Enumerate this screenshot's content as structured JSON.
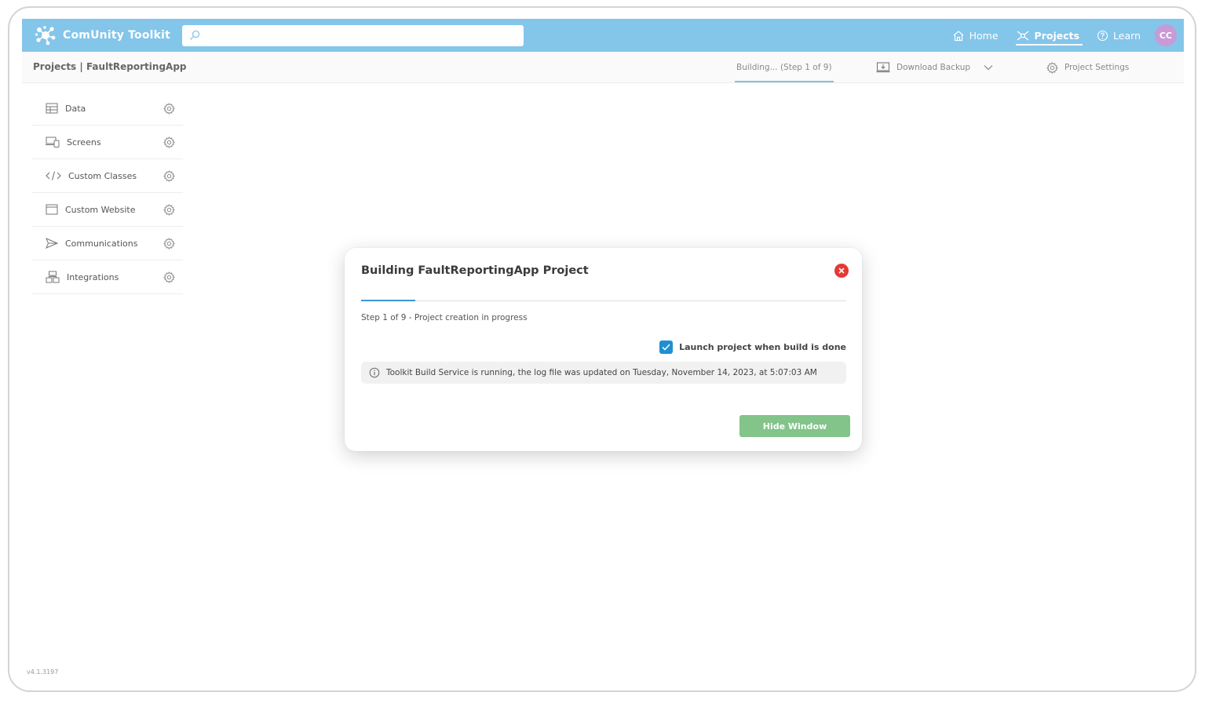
{
  "app": {
    "title": "ComUnity Toolkit",
    "version": "v4.1.3197"
  },
  "search": {
    "placeholder": "",
    "value": ""
  },
  "nav": {
    "home": "Home",
    "projects": "Projects",
    "learn": "Learn",
    "avatar": "CC"
  },
  "subbar": {
    "breadcrumb": "Projects | FaultReportingApp",
    "building": "Building... (Step 1 of 9)",
    "download": "Download Backup",
    "settings": "Project Settings"
  },
  "sidebar": {
    "items": [
      {
        "label": "Data",
        "icon": "table-icon"
      },
      {
        "label": "Screens",
        "icon": "devices-icon"
      },
      {
        "label": "Custom Classes",
        "icon": "code-icon"
      },
      {
        "label": "Custom Website",
        "icon": "browser-icon"
      },
      {
        "label": "Communications",
        "icon": "send-icon"
      },
      {
        "label": "Integrations",
        "icon": "integrations-icon"
      }
    ]
  },
  "modal": {
    "title": "Building FaultReportingApp Project",
    "progress": 0.111,
    "step_text": "Step 1 of 9 - Project creation in progress",
    "launch_label": "Launch project when build is done",
    "launch_checked": true,
    "info": "Toolkit Build Service is running, the log file was updated on Tuesday, November 14, 2023, at 5:07:03 AM",
    "hide_label": "Hide Window"
  },
  "colors": {
    "topbar": "#84c5ea",
    "accent": "#3b97d3",
    "close": "#e53935",
    "hide_button": "#82c48a",
    "avatar": "#c89ad6"
  }
}
